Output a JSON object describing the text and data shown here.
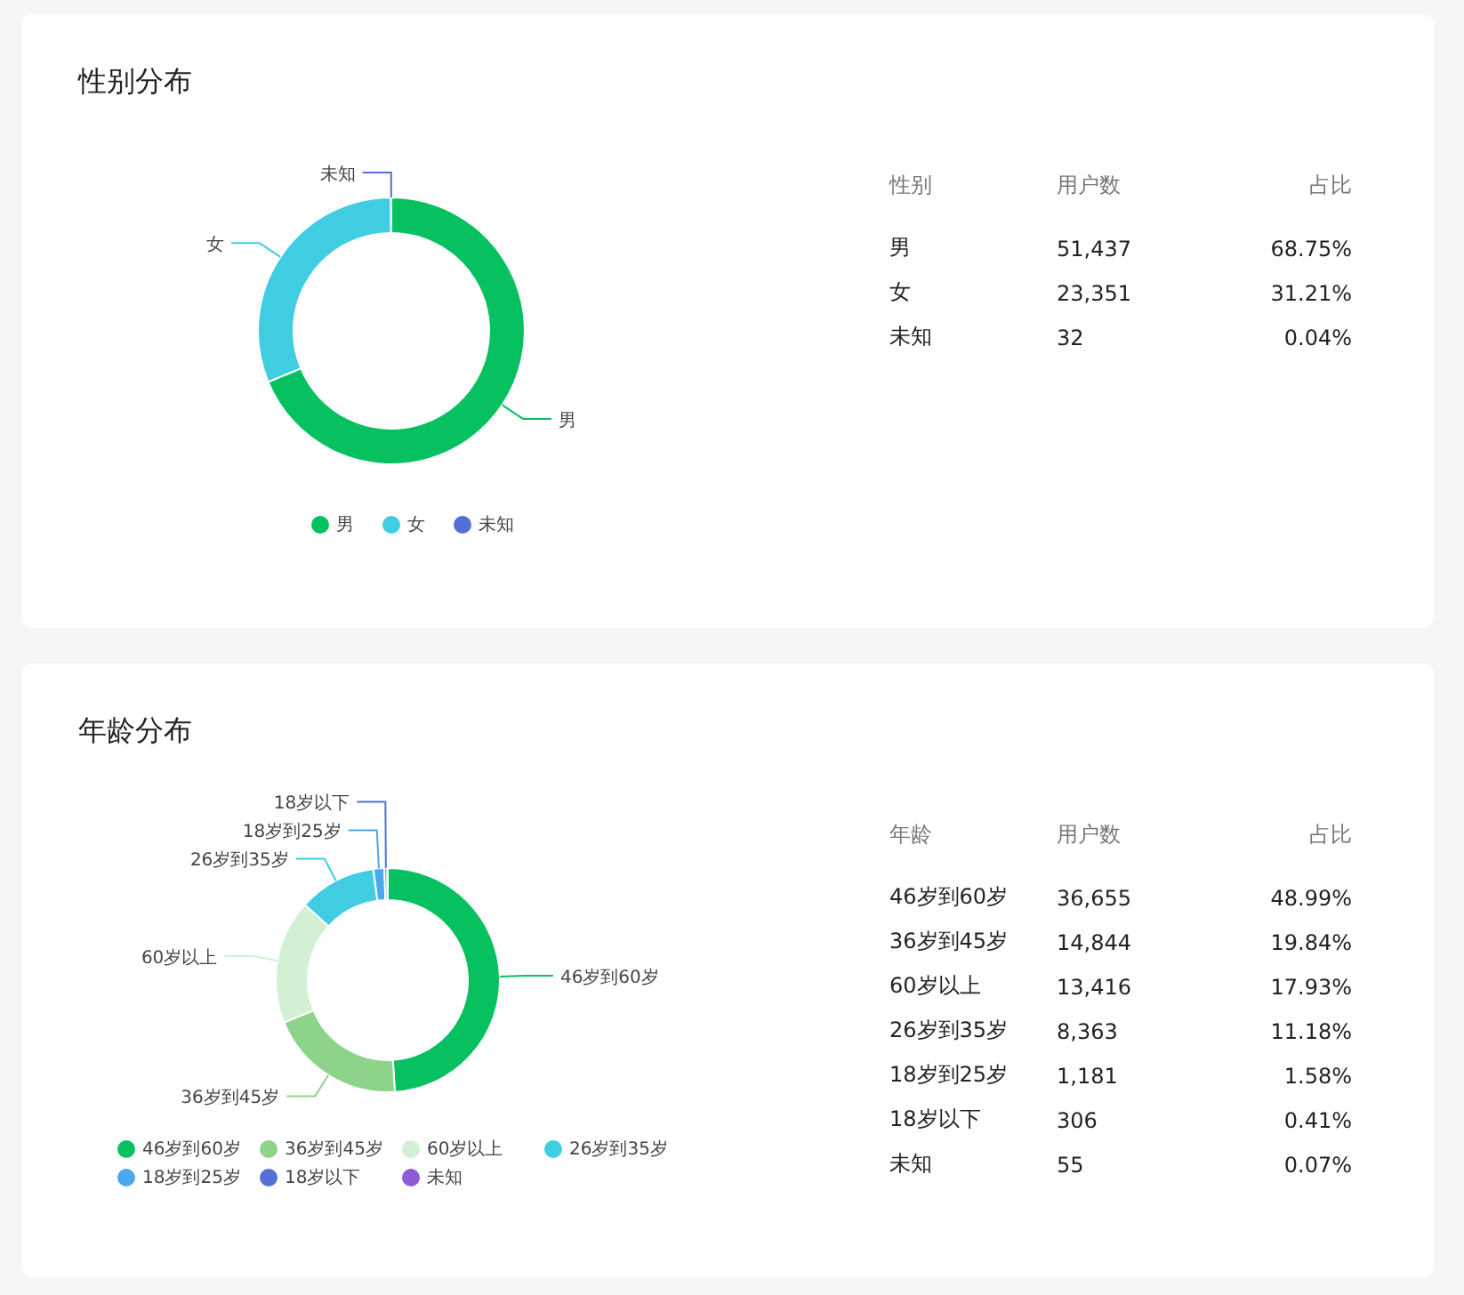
{
  "cards": [
    {
      "title": "性别分布",
      "chart_data": {
        "type": "donut",
        "categories": [
          "男",
          "女",
          "未知"
        ],
        "values": [
          68.75,
          31.21,
          0.04
        ]
      },
      "legend": [
        {
          "color": "#07c160"
        },
        {
          "color": "#40cde2"
        },
        {
          "color": "#5470d6"
        }
      ],
      "table": {
        "columns": [
          "性别",
          "用户数",
          "占比"
        ],
        "rows": [
          [
            "男",
            "51,437",
            "68.75%"
          ],
          [
            "女",
            "23,351",
            "31.21%"
          ],
          [
            "未知",
            "32",
            "0.04%"
          ]
        ]
      }
    },
    {
      "title": "年龄分布",
      "chart_data": {
        "type": "donut",
        "categories": [
          "46岁到60岁",
          "36岁到45岁",
          "60岁以上",
          "26岁到35岁",
          "18岁到25岁",
          "18岁以下",
          "未知"
        ],
        "values": [
          48.99,
          19.84,
          17.93,
          11.18,
          1.58,
          0.41,
          0.07
        ]
      },
      "legend": [
        {
          "color": "#07c160"
        },
        {
          "color": "#8dd48a"
        },
        {
          "color": "#d3efd4"
        },
        {
          "color": "#40cde2"
        },
        {
          "color": "#4ba8ee"
        },
        {
          "color": "#5470d6"
        },
        {
          "color": "#8e5bd6"
        }
      ],
      "table": {
        "columns": [
          "年龄",
          "用户数",
          "占比"
        ],
        "rows": [
          [
            "46岁到60岁",
            "36,655",
            "48.99%"
          ],
          [
            "36岁到45岁",
            "14,844",
            "19.84%"
          ],
          [
            "60岁以上",
            "13,416",
            "17.93%"
          ],
          [
            "26岁到35岁",
            "8,363",
            "11.18%"
          ],
          [
            "18岁到25岁",
            "1,181",
            "1.58%"
          ],
          [
            "18岁以下",
            "306",
            "0.41%"
          ],
          [
            "未知",
            "55",
            "0.07%"
          ]
        ]
      }
    }
  ]
}
